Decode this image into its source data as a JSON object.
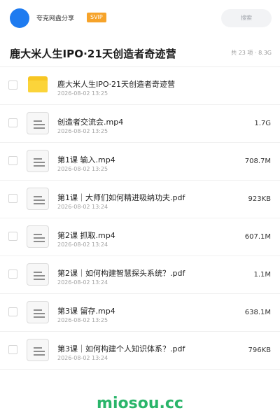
{
  "header": {
    "user_name": "夸克网盘分享",
    "badge": "SVIP",
    "search_placeholder": "搜索",
    "avatar_color": "#1e7bf0",
    "badge_color": "#f6a32a"
  },
  "share": {
    "title": "鹿大米人生IPO·21天创造者奇迹营",
    "meta": "共 23 项 · 8.3G"
  },
  "files": [
    {
      "type": "folder-icon",
      "name": "鹿大米人生IPO·21天创造者奇迹营",
      "date": "2026-08-02 13:25",
      "size": ""
    },
    {
      "type": "document-icon",
      "name": "创造者交流会.mp4",
      "date": "2026-08-02 13:25",
      "size": "1.7G"
    },
    {
      "type": "document-icon",
      "name": "第1课 输入.mp4",
      "date": "2026-08-02 13:25",
      "size": "708.7M"
    },
    {
      "type": "document-icon",
      "name": "第1课｜大师们如何精进吸纳功夫.pdf",
      "date": "2026-08-02 13:24",
      "size": "923KB"
    },
    {
      "type": "document-icon",
      "name": "第2课 抓取.mp4",
      "date": "2026-08-02 13:24",
      "size": "607.1M"
    },
    {
      "type": "document-icon",
      "name": "第2课｜如何构建智慧探头系统？.pdf",
      "date": "2026-08-02 13:24",
      "size": "1.1M"
    },
    {
      "type": "document-icon",
      "name": "第3课 留存.mp4",
      "date": "2026-08-02 13:25",
      "size": "638.1M"
    },
    {
      "type": "document-icon",
      "name": "第3课｜如何构建个人知识体系？.pdf",
      "date": "2026-08-02 13:24",
      "size": "796KB"
    }
  ],
  "watermark": "miosou.cc",
  "watermark_color": "#2ab56a"
}
